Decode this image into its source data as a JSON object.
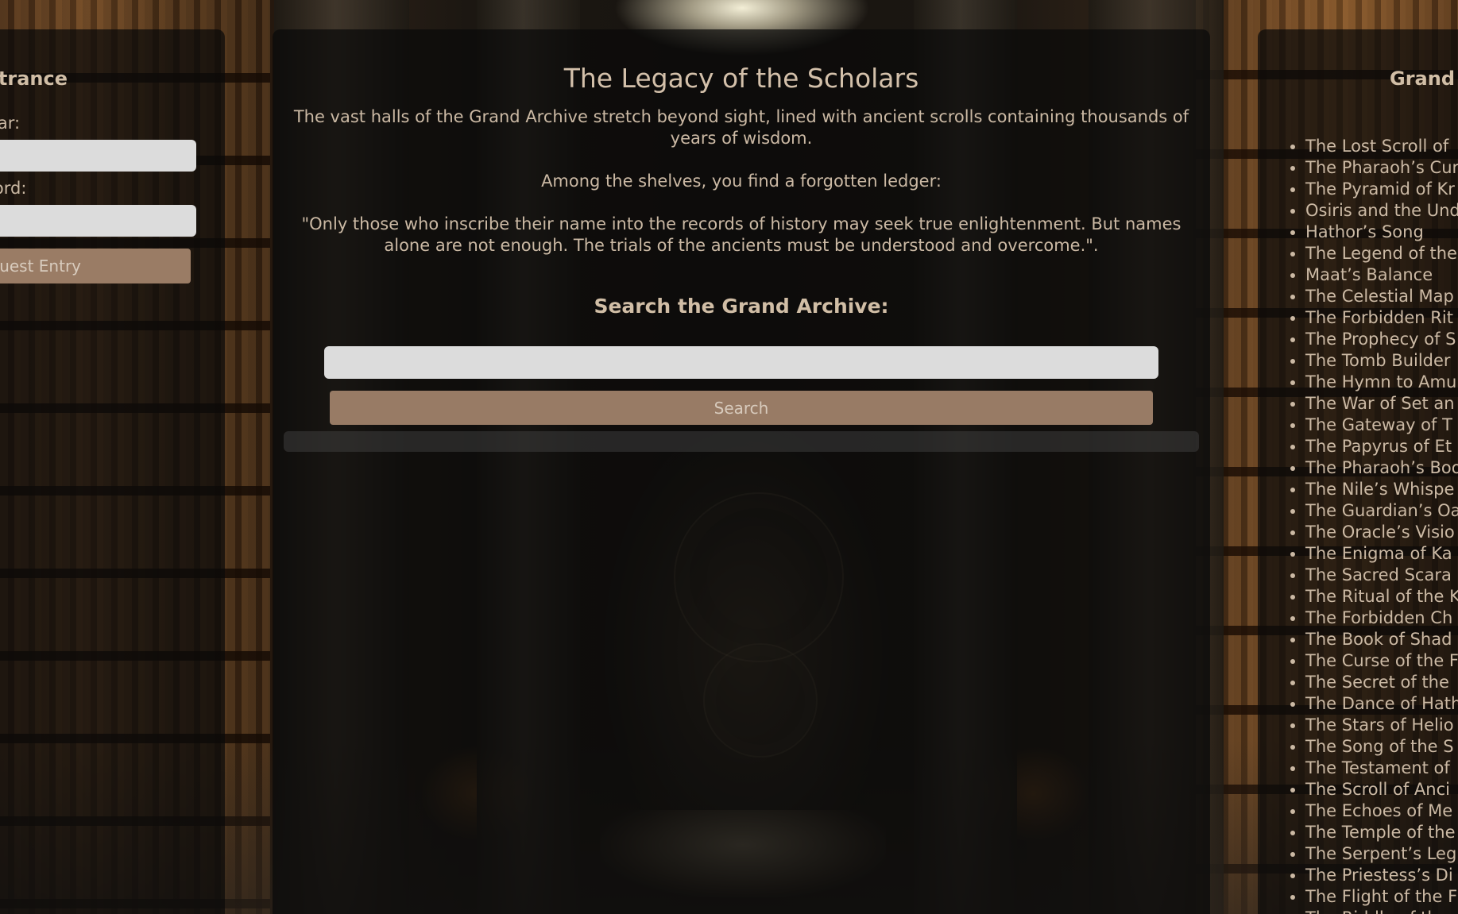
{
  "left_panel": {
    "title": "ntrance",
    "scholar_label": "Scholar:",
    "password_label": "assword:",
    "guest_button": "uest Entry"
  },
  "main_panel": {
    "title": "The Legacy of the Scholars",
    "paragraph1": "The vast halls of the Grand Archive stretch beyond sight, lined with ancient scrolls containing thousands of years of wisdom.",
    "paragraph2": "Among the shelves, you find a forgotten ledger:",
    "paragraph3": "\"Only those who inscribe their name into the records of history may seek true enlightenment. But names alone are not enough. The trials of the ancients must be understood and overcome.\".",
    "search_heading": "Search the Grand Archive:",
    "search_placeholder": "",
    "search_button": "Search"
  },
  "right_panel": {
    "title": "Grand A",
    "scrolls": [
      "The Lost Scroll of",
      "The Pharaoh’s Cur",
      "The Pyramid of Kr",
      "Osiris and the Und",
      "Hathor’s Song",
      "The Legend of the",
      "Maat’s Balance",
      "The Celestial Map",
      "The Forbidden Rit",
      "The Prophecy of S",
      "The Tomb Builder",
      "The Hymn to Amu",
      "The War of Set an",
      "The Gateway of T",
      "The Papyrus of Et",
      "The Pharaoh’s Boo",
      "The Nile’s Whispe",
      "The Guardian’s Oa",
      "The Oracle’s Visio",
      "The Enigma of Ka",
      "The Sacred Scara",
      "The Ritual of the K",
      "The Forbidden Ch",
      "The Book of Shad",
      "The Curse of the F",
      "The Secret of the",
      "The Dance of Hath",
      "The Stars of Helio",
      "The Song of the S",
      "The Testament of",
      "The Scroll of Anci",
      "The Echoes of Me",
      "The Temple of the",
      "The Serpent’s Leg",
      "The Priestess’s Di",
      "The Flight of the F",
      "The Riddle of the"
    ]
  }
}
